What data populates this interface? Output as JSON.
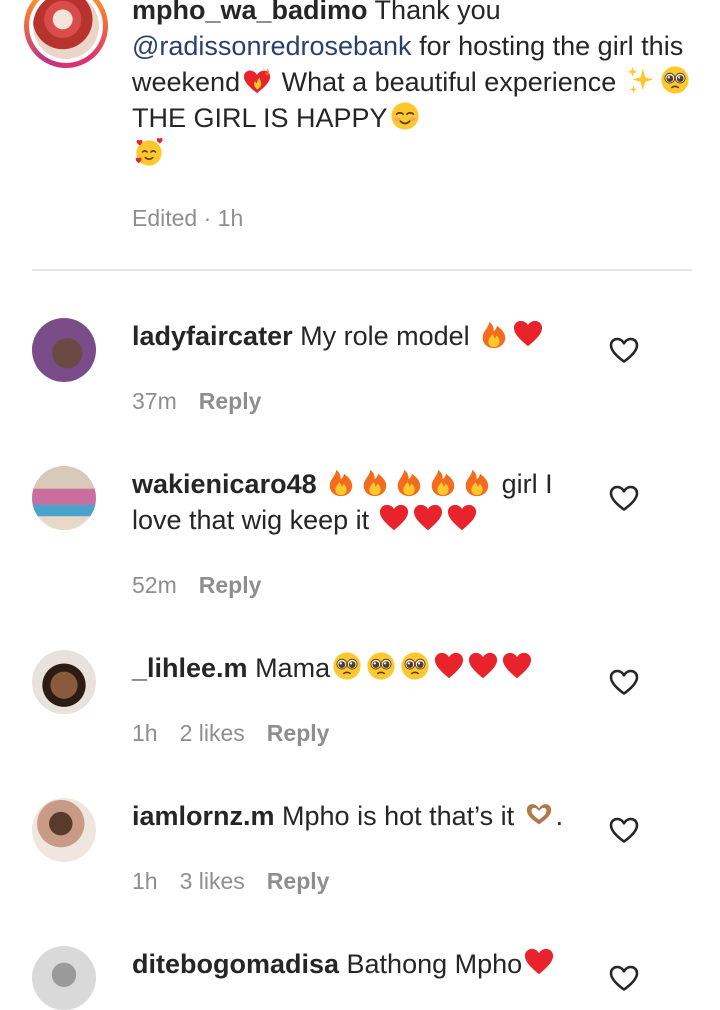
{
  "caption": {
    "username": "mpho_wa_badimo",
    "text_before_mention": " Thank you ",
    "mention": "@radissonredrosebank",
    "text_after_mention": " for hosting the girl this weekend",
    "text_mid": " What a beautiful experience ",
    "text_end": "THE GIRL IS HAPPY",
    "edited_label": "Edited · 1h",
    "emojis": [
      "heart-on-fire-emoji",
      "sparkles-emoji",
      "pleading-face-emoji",
      "smiling-blush-emoji",
      "smiling-hearts-emoji"
    ]
  },
  "comments": [
    {
      "username": "ladyfaircater",
      "text": " My role model ",
      "emojis": [
        "fire-emoji",
        "red-heart-emoji"
      ],
      "time": "37m",
      "likes": "",
      "reply_label": "Reply"
    },
    {
      "username": "wakienicaro48",
      "text_prefix": " ",
      "text": " girl I love that wig keep it ",
      "emojis": [
        "fire-emoji",
        "fire-emoji",
        "fire-emoji",
        "fire-emoji",
        "fire-emoji",
        "red-heart-emoji",
        "red-heart-emoji",
        "red-heart-emoji"
      ],
      "time": "52m",
      "likes": "",
      "reply_label": "Reply"
    },
    {
      "username": "_lihlee.m",
      "text": " Mama",
      "emojis": [
        "pleading-face-emoji",
        "pleading-face-emoji",
        "pleading-face-emoji",
        "red-heart-emoji",
        "red-heart-emoji",
        "red-heart-emoji"
      ],
      "time": "1h",
      "likes": "2 likes",
      "reply_label": "Reply"
    },
    {
      "username": "iamlornz.m",
      "text": " Mpho is hot that’s it ",
      "text_end": ".",
      "emojis": [
        "heart-hands-emoji"
      ],
      "time": "1h",
      "likes": "3 likes",
      "reply_label": "Reply"
    },
    {
      "username": "ditebogomadisa",
      "text": " Bathong Mpho",
      "emojis": [
        "red-heart-emoji"
      ],
      "time": "",
      "likes": "",
      "reply_label": ""
    }
  ],
  "colors": {
    "text": "#262626",
    "meta": "#8e8e8e",
    "mention": "#2a3f70",
    "divider": "#e6e6e6",
    "heart_red": "#e8232c",
    "fire_orange": "#f36b1c"
  },
  "icons": {
    "like": "heart-outline-icon"
  }
}
